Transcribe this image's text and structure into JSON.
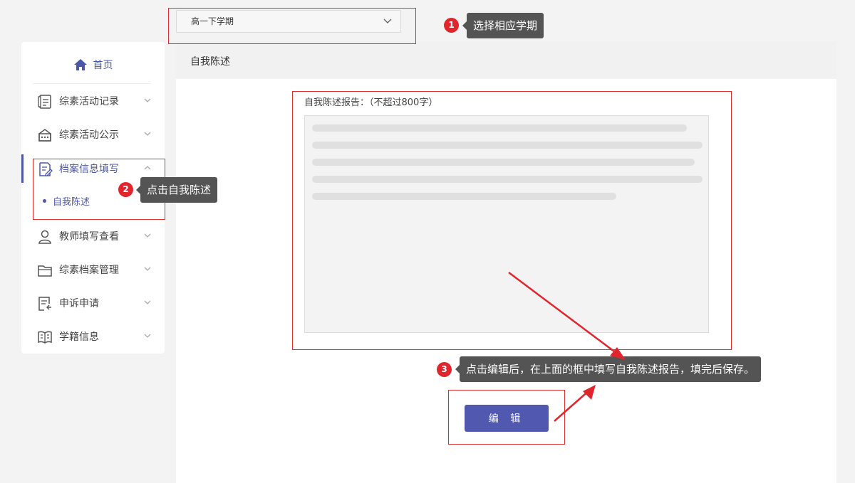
{
  "semester_select": {
    "value": "高一下学期"
  },
  "sidebar": {
    "home_label": "首页",
    "items": [
      {
        "label": "综素活动记录",
        "icon": "record-icon"
      },
      {
        "label": "综素活动公示",
        "icon": "display-icon"
      },
      {
        "label": "档案信息填写",
        "icon": "edit-file-icon"
      },
      {
        "label": "教师填写查看",
        "icon": "user-icon"
      },
      {
        "label": "综素档案管理",
        "icon": "folder-icon"
      },
      {
        "label": "申诉申请",
        "icon": "appeal-icon"
      },
      {
        "label": "学籍信息",
        "icon": "book-icon"
      }
    ],
    "sub_item": "自我陈述"
  },
  "main": {
    "header_title": "自我陈述",
    "report_label": "自我陈述报告：（不超过800字）",
    "edit_button": "编 辑"
  },
  "annotations": {
    "step1": {
      "num": "1",
      "text": "选择相应学期"
    },
    "step2": {
      "num": "2",
      "text": "点击自我陈述"
    },
    "step3": {
      "num": "3",
      "text": "点击编辑后，在上面的框中填写自我陈述报告，填完后保存。"
    }
  },
  "colors": {
    "accent": "#4b57a8",
    "annotation_red": "#d9302c",
    "tooltip_bg": "#545454"
  }
}
